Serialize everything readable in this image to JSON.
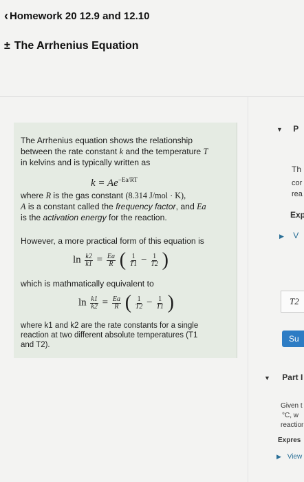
{
  "header": {
    "back_label": "Homework 20 12.9 and 12.10",
    "title_icon": "±",
    "title": "The Arrhenius Equation"
  },
  "content": {
    "intro_1": "The Arrhenius equation shows the relationship",
    "intro_2a": "between the rate constant ",
    "intro_2k": "k",
    "intro_2b": " and the temperature ",
    "intro_2T": "T",
    "intro_3": "in kelvins and is typically written as",
    "eq1": "k = Ae",
    "eq1_exp": "−Ea/RT",
    "where_1a": "where ",
    "where_1R": "R",
    "where_1b": " is the gas constant ",
    "where_1val": "(8.314 J/mol · K),",
    "where_2A": "A",
    "where_2a": " is a constant called the ",
    "where_2i": "frequency factor",
    "where_2b": ", and ",
    "where_2E": "Ea",
    "where_3a": "is the ",
    "where_3i": "activation energy",
    "where_3b": " for the reaction.",
    "however": "However, a more practical form of this equation is",
    "eq2_ln": "ln",
    "eq2_lhs_num": "k2",
    "eq2_lhs_den": "k1",
    "eq2_mid_num": "Ea",
    "eq2_mid_den": "R",
    "eq2_t1_num": "1",
    "eq2_t1_den": "T1",
    "eq2_t2_num": "1",
    "eq2_t2_den": "T2",
    "equiv": "which is mathmatically equivalent to",
    "eq3_ln": "ln",
    "eq3_lhs_num": "k1",
    "eq3_lhs_den": "k2",
    "eq3_mid_num": "Ea",
    "eq3_mid_den": "R",
    "eq3_t1_num": "1",
    "eq3_t1_den": "T2",
    "eq3_t2_num": "1",
    "eq3_t2_den": "T1",
    "final_1": "where k1 and k2 are the rate constants for a single",
    "final_2": "reaction at two different absolute temperatures (T1",
    "final_3": "and T2)."
  },
  "right_panel": {
    "part_top": "P",
    "th": "Th",
    "cor": "cor",
    "rea": "rea",
    "exp": "Exp",
    "view_v": "V",
    "t2": "T2",
    "submit": "Su",
    "part": "Part I",
    "given": "Given t",
    "cw": "°C, w",
    "reaction": "reactior",
    "express": "Expres",
    "view": "View"
  }
}
